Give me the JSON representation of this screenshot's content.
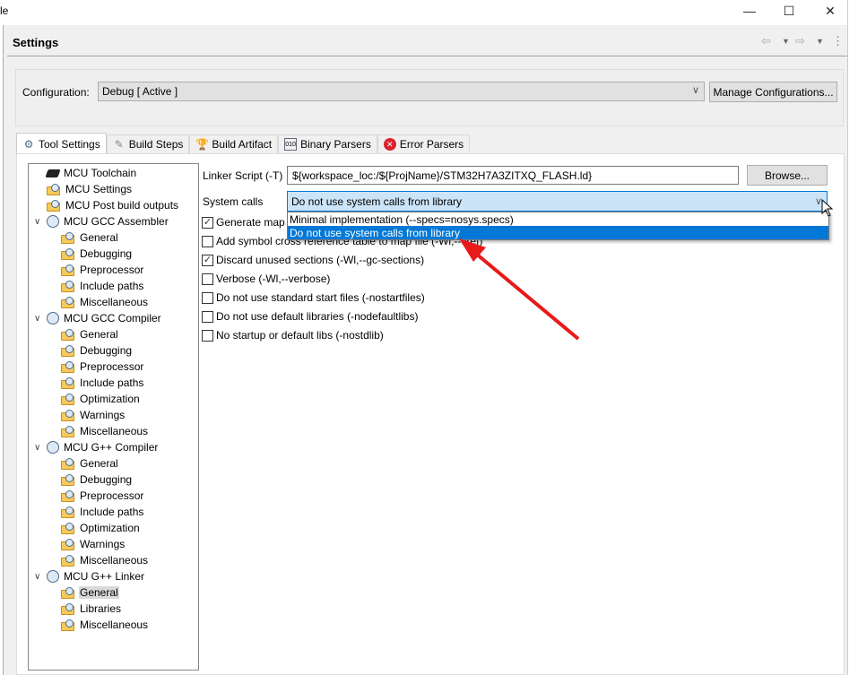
{
  "window": {
    "title_fragment": "le",
    "minimize": "—",
    "maximize": "☐",
    "close": "✕"
  },
  "header": {
    "title": "Settings",
    "back": "⇦",
    "forward": "⇨",
    "menu": "⋮"
  },
  "configuration": {
    "label": "Configuration:",
    "value": "Debug  [ Active ]",
    "manage_label": "Manage Configurations..."
  },
  "tabs": [
    {
      "label": "Tool Settings",
      "icon": "tool-settings-icon",
      "active": true
    },
    {
      "label": "Build Steps",
      "icon": "build-steps-icon"
    },
    {
      "label": "Build Artifact",
      "icon": "build-artifact-icon"
    },
    {
      "label": "Binary Parsers",
      "icon": "binary-parsers-icon"
    },
    {
      "label": "Error Parsers",
      "icon": "error-parsers-icon"
    }
  ],
  "tree": [
    {
      "label": "MCU Toolchain",
      "level": 0,
      "kind": "chip"
    },
    {
      "label": "MCU Settings",
      "level": 0,
      "kind": "folder"
    },
    {
      "label": "MCU Post build outputs",
      "level": 0,
      "kind": "folder"
    },
    {
      "label": "MCU GCC Assembler",
      "level": 0,
      "kind": "tool",
      "expanded": true
    },
    {
      "label": "General",
      "level": 1,
      "kind": "folder"
    },
    {
      "label": "Debugging",
      "level": 1,
      "kind": "folder"
    },
    {
      "label": "Preprocessor",
      "level": 1,
      "kind": "folder"
    },
    {
      "label": "Include paths",
      "level": 1,
      "kind": "folder"
    },
    {
      "label": "Miscellaneous",
      "level": 1,
      "kind": "folder"
    },
    {
      "label": "MCU GCC Compiler",
      "level": 0,
      "kind": "tool",
      "expanded": true
    },
    {
      "label": "General",
      "level": 1,
      "kind": "folder"
    },
    {
      "label": "Debugging",
      "level": 1,
      "kind": "folder"
    },
    {
      "label": "Preprocessor",
      "level": 1,
      "kind": "folder"
    },
    {
      "label": "Include paths",
      "level": 1,
      "kind": "folder"
    },
    {
      "label": "Optimization",
      "level": 1,
      "kind": "folder"
    },
    {
      "label": "Warnings",
      "level": 1,
      "kind": "folder"
    },
    {
      "label": "Miscellaneous",
      "level": 1,
      "kind": "folder"
    },
    {
      "label": "MCU G++ Compiler",
      "level": 0,
      "kind": "tool",
      "expanded": true
    },
    {
      "label": "General",
      "level": 1,
      "kind": "folder"
    },
    {
      "label": "Debugging",
      "level": 1,
      "kind": "folder"
    },
    {
      "label": "Preprocessor",
      "level": 1,
      "kind": "folder"
    },
    {
      "label": "Include paths",
      "level": 1,
      "kind": "folder"
    },
    {
      "label": "Optimization",
      "level": 1,
      "kind": "folder"
    },
    {
      "label": "Warnings",
      "level": 1,
      "kind": "folder"
    },
    {
      "label": "Miscellaneous",
      "level": 1,
      "kind": "folder"
    },
    {
      "label": "MCU G++ Linker",
      "level": 0,
      "kind": "tool",
      "expanded": true
    },
    {
      "label": "General",
      "level": 1,
      "kind": "folder",
      "selected": true
    },
    {
      "label": "Libraries",
      "level": 1,
      "kind": "folder"
    },
    {
      "label": "Miscellaneous",
      "level": 1,
      "kind": "folder"
    }
  ],
  "linker": {
    "script_label": "Linker Script (-T)",
    "script_value": "${workspace_loc:/${ProjName}/STM32H7A3ZITXQ_FLASH.ld}",
    "browse_label": "Browse...",
    "syscalls_label": "System calls",
    "syscalls_value": "Do not use system calls from library",
    "syscalls_options": [
      "Minimal implementation (--specs=nosys.specs)",
      "Do not use system calls from library"
    ],
    "syscalls_highlighted": 1,
    "options": [
      {
        "label": "Generate map file",
        "checked": true
      },
      {
        "label": "Add symbol cross reference table to map file (-Wl,--cref)",
        "checked": false
      },
      {
        "label": "Discard unused sections (-Wl,--gc-sections)",
        "checked": true
      },
      {
        "label": "Verbose (-Wl,--verbose)",
        "checked": false
      },
      {
        "label": "Do not use standard start files (-nostartfiles)",
        "checked": false
      },
      {
        "label": "Do not use default libraries (-nodefaultlibs)",
        "checked": false
      },
      {
        "label": "No startup or default libs (-nostdlib)",
        "checked": false
      }
    ]
  },
  "colors": {
    "selection": "#0078d7",
    "combo_focus": "#cce4f7",
    "arrow": "#e81a1a"
  }
}
